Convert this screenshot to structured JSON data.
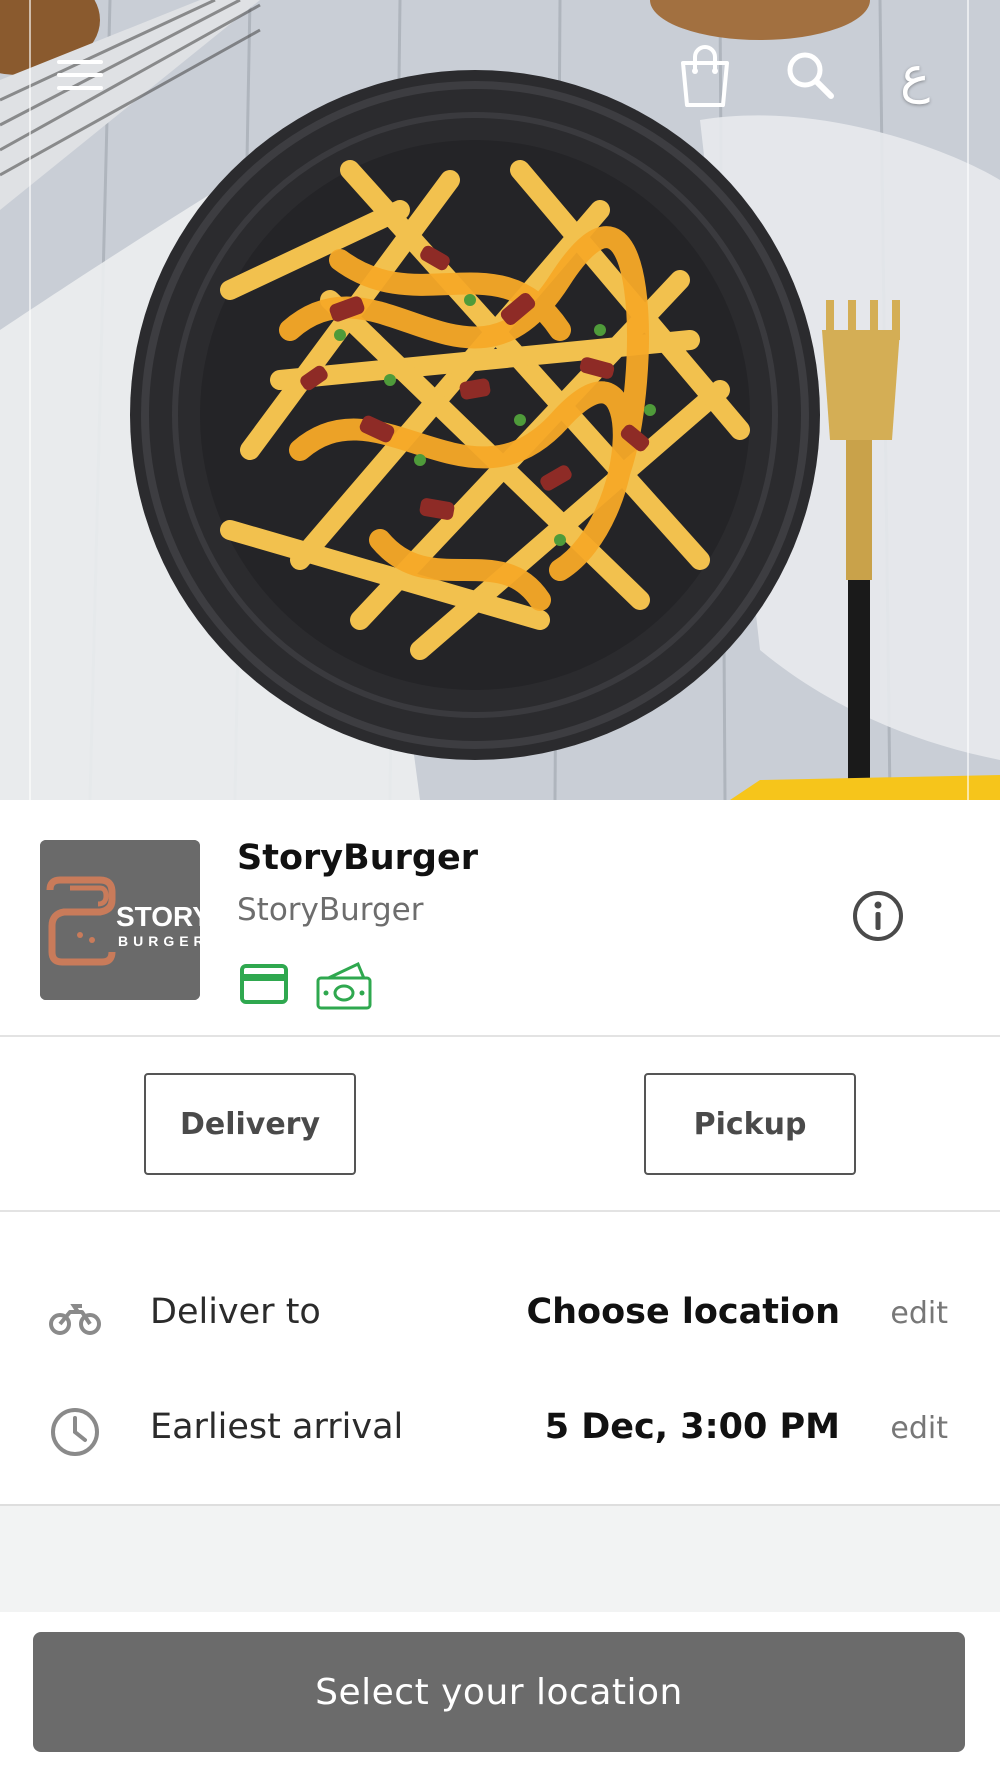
{
  "header": {
    "language_toggle": "ع",
    "icons": [
      "menu-icon",
      "shopping-bag-icon",
      "search-icon"
    ]
  },
  "restaurant": {
    "name": "StoryBurger",
    "subtitle": "StoryBurger",
    "logo_text": {
      "main": "STORY",
      "sub": "BURGER"
    },
    "payment_icons": [
      "credit-card-icon",
      "cash-icon"
    ],
    "accent_color": "#2fa84f"
  },
  "order_type": {
    "delivery_label": "Delivery",
    "pickup_label": "Pickup"
  },
  "details": {
    "deliver_to": {
      "label": "Deliver to",
      "value": "Choose location",
      "edit": "edit"
    },
    "arrival": {
      "label": "Earliest arrival",
      "value": "5 Dec, 3:00 PM",
      "edit": "edit"
    }
  },
  "footer": {
    "cta_label": "Select your location",
    "cta_color": "#6b6b6b"
  }
}
